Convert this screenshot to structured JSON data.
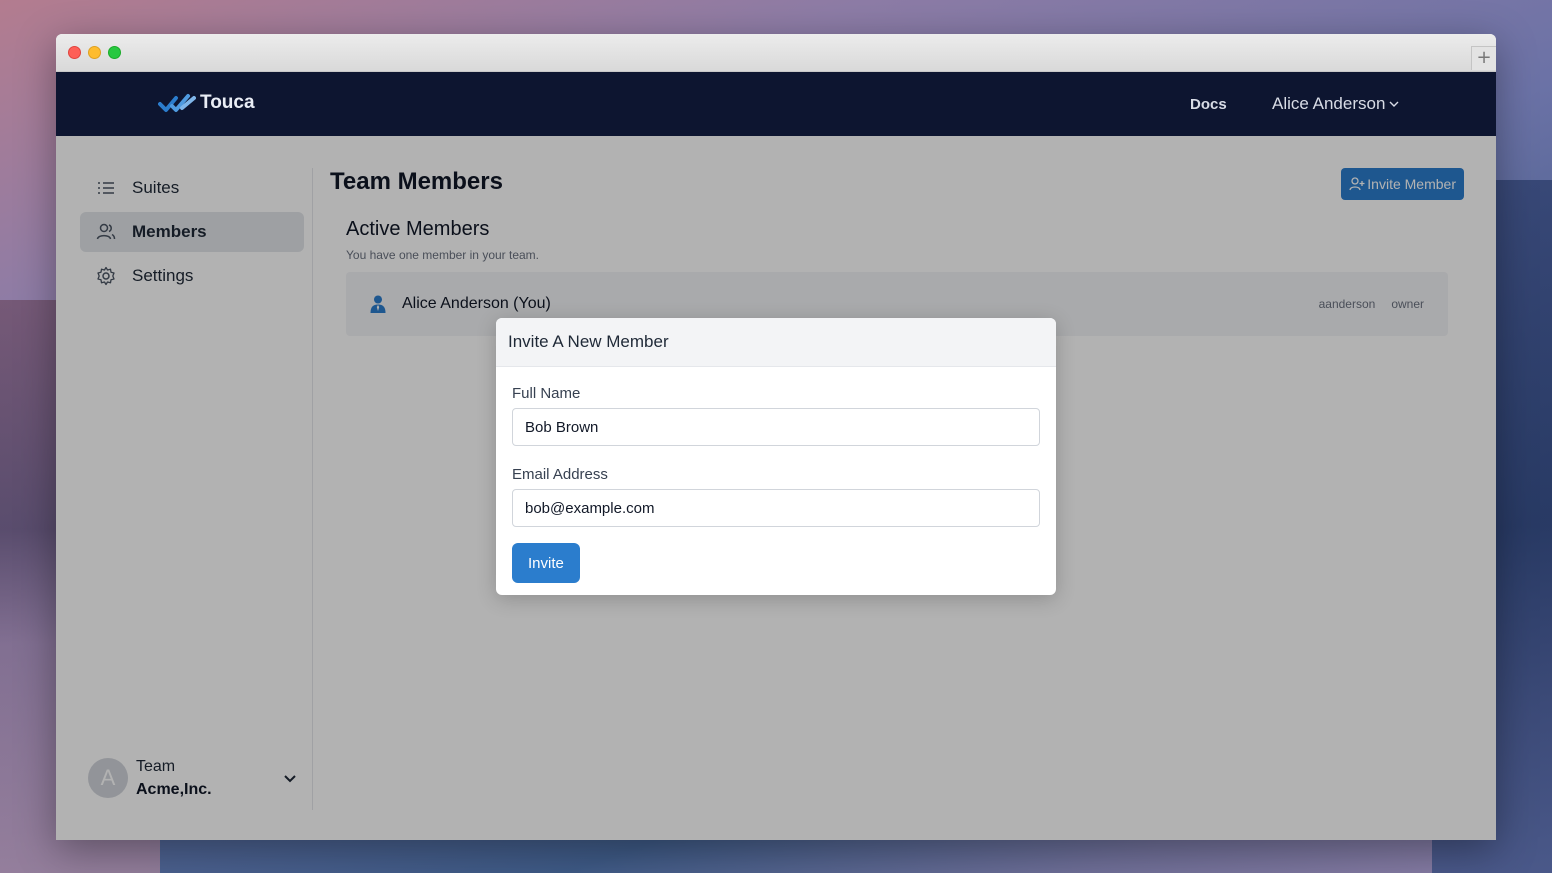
{
  "window": {
    "new_tab_label": "+"
  },
  "navbar": {
    "brand": "Touca",
    "docs_label": "Docs",
    "user_name": "Alice Anderson"
  },
  "sidebar": {
    "items": [
      {
        "label": "Suites",
        "icon": "list-icon",
        "active": false
      },
      {
        "label": "Members",
        "icon": "users-icon",
        "active": true
      },
      {
        "label": "Settings",
        "icon": "gear-icon",
        "active": false
      }
    ],
    "team": {
      "avatar_letter": "A",
      "label": "Team",
      "name": "Acme,Inc."
    }
  },
  "main": {
    "title": "Team Members",
    "invite_button_label": "Invite Member",
    "section_title": "Active Members",
    "section_subtitle": "You have one member in your team.",
    "members": [
      {
        "name": "Alice Anderson (You)",
        "username": "aanderson",
        "role": "owner"
      }
    ]
  },
  "modal": {
    "title": "Invite A New Member",
    "fullname_label": "Full Name",
    "fullname_value": "Bob Brown",
    "email_label": "Email Address",
    "email_value": "bob@example.com",
    "submit_label": "Invite"
  },
  "colors": {
    "navbar_bg": "#0d1530",
    "accent": "#2b7dcd"
  }
}
